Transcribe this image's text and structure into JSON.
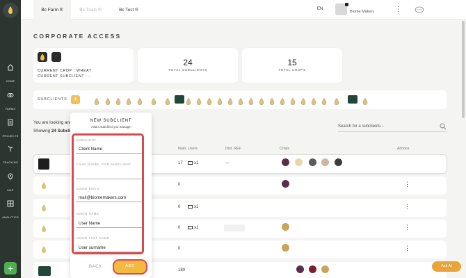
{
  "sidebar": {
    "items": [
      {
        "label": "HOME",
        "icon": "home-icon"
      },
      {
        "label": "FARMS",
        "icon": "farms-icon"
      },
      {
        "label": "PROJECTS",
        "icon": "projects-icon"
      },
      {
        "label": "TRACKING",
        "icon": "tracking-icon"
      },
      {
        "label": "MAP",
        "icon": "map-pin-icon"
      },
      {
        "label": "ANALYTICS",
        "icon": "analytics-icon"
      }
    ],
    "add_label": "+"
  },
  "topbar": {
    "tabs": [
      {
        "label": "Bc Farm ®",
        "state": "active"
      },
      {
        "label": "Bc Trials ®",
        "state": "inactive"
      },
      {
        "label": "Bc Test ®",
        "state": "default"
      }
    ],
    "language": "EN",
    "user_org": "Biome Makers"
  },
  "page": {
    "title": "CORPORATE ACCESS",
    "current_crop": "CURRENT CROP : WHEAT",
    "current_subclient": "CURRENT SUBCLIENT : -",
    "stats": [
      {
        "value": "24",
        "label": "TOTAL SUBCLIENTS"
      },
      {
        "value": "15",
        "label": "TOTAL CROPS"
      }
    ],
    "subclients_label": "SUBCLIENTS",
    "intro_line1": "You are looking and",
    "intro_line2_prefix": "Showing ",
    "intro_line2_bold": "24 Subcli",
    "search_placeholder": "Search for a subclients..."
  },
  "table": {
    "headers": [
      "Num. Users",
      "Dist. REF",
      "Crops",
      "Actions"
    ],
    "rows": [
      {
        "users": "17",
        "invites": "x1",
        "ref": "---"
      },
      {
        "users": "0",
        "invites": "",
        "ref": ""
      },
      {
        "users": "0",
        "invites": "x1",
        "ref": ""
      },
      {
        "users": "0",
        "invites": "x1",
        "ref": ""
      },
      {
        "users": "0",
        "invites": "",
        "ref": ""
      },
      {
        "users": "180",
        "invites": "",
        "ref": ""
      }
    ]
  },
  "modal": {
    "title": "NEW SUBCLIENT",
    "subtitle": "Add a subclient you manage",
    "section_label": "SUBCLIENT",
    "fields": [
      {
        "value": "Client Name"
      },
      {
        "label": "YOUR ID/REF. FOR SUBCLIENT",
        "value": ""
      },
      {
        "label": "ADMIN EMAIL",
        "value": "mail@biomemakers.com"
      },
      {
        "label": "ADMIN NAME",
        "value": "User Name"
      },
      {
        "label": "ADMIN LAST NAME",
        "value": "User surname"
      }
    ],
    "back_label": "BACK",
    "add_label": "ADD"
  },
  "ask_ai_label": "Ask AI",
  "colors": {
    "accent": "#f4b941",
    "sidebar": "#2d3530",
    "highlight": "#d94a4a",
    "add_green": "#4caf50"
  }
}
